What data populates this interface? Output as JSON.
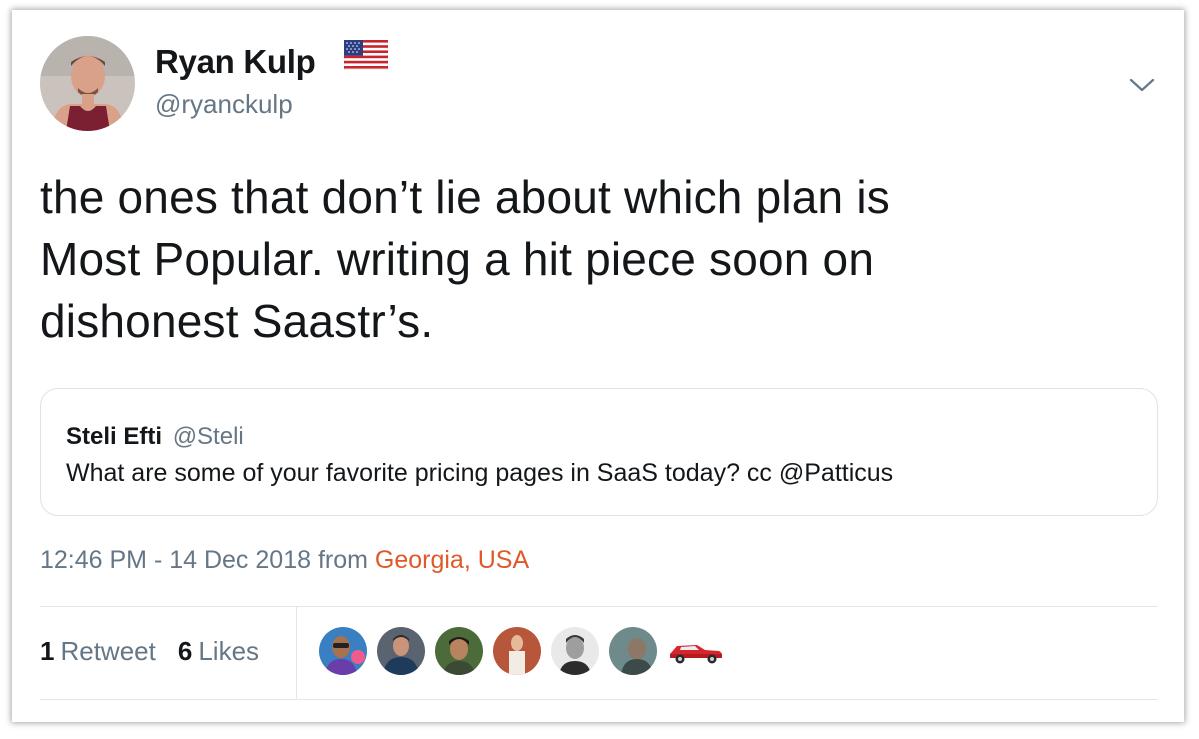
{
  "author": {
    "display_name": "Ryan Kulp",
    "handle": "@ryanckulp",
    "avatar_icon": "profile-photo",
    "flag_icon": "us-flag-emoji"
  },
  "tweet": {
    "text": "the ones that don’t lie about which plan is\nMost Popular. writing a hit piece soon on\ndishonest Saastr’s."
  },
  "quoted_tweet": {
    "author_name": "Steli Efti",
    "author_handle": "@Steli",
    "text": "What are some of your favorite pricing pages in SaaS today? cc @Patticus"
  },
  "meta": {
    "timestamp": "12:46 PM - 14 Dec 2018 from ",
    "location": "Georgia, USA"
  },
  "stats": {
    "retweet_count": "1",
    "retweet_label": "Retweet",
    "like_count": "6",
    "like_label": "Likes"
  },
  "likers": [
    {
      "icon": "liker-avatar-1"
    },
    {
      "icon": "liker-avatar-2"
    },
    {
      "icon": "liker-avatar-3"
    },
    {
      "icon": "liker-avatar-4"
    },
    {
      "icon": "liker-avatar-5"
    },
    {
      "icon": "liker-avatar-6"
    },
    {
      "icon": "red-car-avatar"
    }
  ],
  "colors": {
    "text": "#14171a",
    "secondary": "#657786",
    "location_link": "#e0592a",
    "border": "#e1e8ed"
  }
}
